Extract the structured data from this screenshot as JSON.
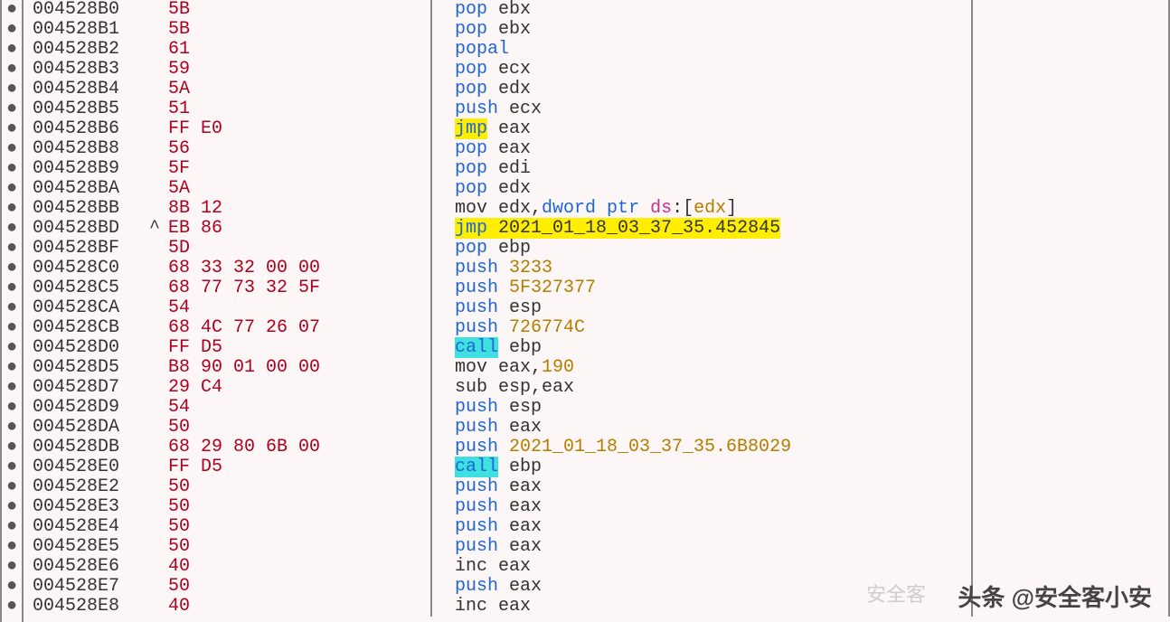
{
  "watermark": "头条 @安全客小安",
  "faded_text": "安全客",
  "rows": [
    {
      "addr": "004528B0",
      "marker": "",
      "bytes": "5B",
      "asm": [
        {
          "t": "pop ",
          "c": "mn"
        },
        {
          "t": "ebx",
          "c": "reg"
        }
      ]
    },
    {
      "addr": "004528B1",
      "marker": "",
      "bytes": "5B",
      "asm": [
        {
          "t": "pop ",
          "c": "mn"
        },
        {
          "t": "ebx",
          "c": "reg"
        }
      ]
    },
    {
      "addr": "004528B2",
      "marker": "",
      "bytes": "61",
      "asm": [
        {
          "t": "popal",
          "c": "mn"
        }
      ]
    },
    {
      "addr": "004528B3",
      "marker": "",
      "bytes": "59",
      "asm": [
        {
          "t": "pop ",
          "c": "mn"
        },
        {
          "t": "ecx",
          "c": "reg"
        }
      ]
    },
    {
      "addr": "004528B4",
      "marker": "",
      "bytes": "5A",
      "asm": [
        {
          "t": "pop ",
          "c": "mn"
        },
        {
          "t": "edx",
          "c": "reg"
        }
      ]
    },
    {
      "addr": "004528B5",
      "marker": "",
      "bytes": "51",
      "asm": [
        {
          "t": "push ",
          "c": "mn"
        },
        {
          "t": "ecx",
          "c": "reg"
        }
      ]
    },
    {
      "addr": "004528B6",
      "marker": "",
      "bytes": "FF E0",
      "asm": [
        {
          "t": "jmp",
          "c": "hl-y"
        },
        {
          "t": " ",
          "c": "txt"
        },
        {
          "t": "eax",
          "c": "reg"
        }
      ]
    },
    {
      "addr": "004528B8",
      "marker": "",
      "bytes": "56",
      "asm": [
        {
          "t": "pop ",
          "c": "mn"
        },
        {
          "t": "eax",
          "c": "reg"
        }
      ]
    },
    {
      "addr": "004528B9",
      "marker": "",
      "bytes": "5F",
      "asm": [
        {
          "t": "pop ",
          "c": "mn"
        },
        {
          "t": "edi",
          "c": "reg"
        }
      ]
    },
    {
      "addr": "004528BA",
      "marker": "",
      "bytes": "5A",
      "asm": [
        {
          "t": "pop ",
          "c": "mn"
        },
        {
          "t": "edx",
          "c": "reg"
        }
      ]
    },
    {
      "addr": "004528BB",
      "marker": "",
      "bytes": "8B 12",
      "asm": [
        {
          "t": "mov ",
          "c": "txt"
        },
        {
          "t": "edx",
          "c": "reg"
        },
        {
          "t": ",",
          "c": "txt"
        },
        {
          "t": "dword ptr ",
          "c": "mn"
        },
        {
          "t": "ds",
          "c": "seg"
        },
        {
          "t": ":[",
          "c": "txt"
        },
        {
          "t": "edx",
          "c": "num"
        },
        {
          "t": "]",
          "c": "txt"
        }
      ]
    },
    {
      "addr": "004528BD",
      "marker": "^",
      "bytes": "EB 86",
      "asm": [
        {
          "t": "jmp",
          "c": "hl-y"
        },
        {
          "t": " ",
          "c": "hl-y2"
        },
        {
          "t": "2021_01_18_03_37_35.452845",
          "c": "hl-y2"
        }
      ]
    },
    {
      "addr": "004528BF",
      "marker": "",
      "bytes": "5D",
      "asm": [
        {
          "t": "pop ",
          "c": "mn"
        },
        {
          "t": "ebp",
          "c": "reg"
        }
      ]
    },
    {
      "addr": "004528C0",
      "marker": "",
      "bytes": "68 33 32 00 00",
      "asm": [
        {
          "t": "push ",
          "c": "mn"
        },
        {
          "t": "3233",
          "c": "num"
        }
      ]
    },
    {
      "addr": "004528C5",
      "marker": "",
      "bytes": "68 77 73 32 5F",
      "asm": [
        {
          "t": "push ",
          "c": "mn"
        },
        {
          "t": "5F327377",
          "c": "num"
        }
      ]
    },
    {
      "addr": "004528CA",
      "marker": "",
      "bytes": "54",
      "asm": [
        {
          "t": "push ",
          "c": "mn"
        },
        {
          "t": "esp",
          "c": "reg"
        }
      ]
    },
    {
      "addr": "004528CB",
      "marker": "",
      "bytes": "68 4C 77 26 07",
      "asm": [
        {
          "t": "push ",
          "c": "mn"
        },
        {
          "t": "726774C",
          "c": "num"
        }
      ]
    },
    {
      "addr": "004528D0",
      "marker": "",
      "bytes": "FF D5",
      "asm": [
        {
          "t": "call",
          "c": "hl-c"
        },
        {
          "t": " ",
          "c": "txt"
        },
        {
          "t": "ebp",
          "c": "reg"
        }
      ]
    },
    {
      "addr": "004528D5",
      "marker": "",
      "bytes": "B8 90 01 00 00",
      "asm": [
        {
          "t": "mov ",
          "c": "txt"
        },
        {
          "t": "eax",
          "c": "reg"
        },
        {
          "t": ",",
          "c": "txt"
        },
        {
          "t": "190",
          "c": "num"
        }
      ]
    },
    {
      "addr": "004528D7",
      "marker": "",
      "bytes": "29 C4",
      "asm": [
        {
          "t": "sub ",
          "c": "txt"
        },
        {
          "t": "esp",
          "c": "reg"
        },
        {
          "t": ",",
          "c": "txt"
        },
        {
          "t": "eax",
          "c": "reg"
        }
      ]
    },
    {
      "addr": "004528D9",
      "marker": "",
      "bytes": "54",
      "asm": [
        {
          "t": "push ",
          "c": "mn"
        },
        {
          "t": "esp",
          "c": "reg"
        }
      ]
    },
    {
      "addr": "004528DA",
      "marker": "",
      "bytes": "50",
      "asm": [
        {
          "t": "push ",
          "c": "mn"
        },
        {
          "t": "eax",
          "c": "reg"
        }
      ]
    },
    {
      "addr": "004528DB",
      "marker": "",
      "bytes": "68 29 80 6B 00",
      "asm": [
        {
          "t": "push ",
          "c": "mn"
        },
        {
          "t": "2021_01_18_03_37_35.6B8029",
          "c": "num"
        }
      ]
    },
    {
      "addr": "004528E0",
      "marker": "",
      "bytes": "FF D5",
      "asm": [
        {
          "t": "call",
          "c": "hl-c"
        },
        {
          "t": " ",
          "c": "txt"
        },
        {
          "t": "ebp",
          "c": "reg"
        }
      ]
    },
    {
      "addr": "004528E2",
      "marker": "",
      "bytes": "50",
      "asm": [
        {
          "t": "push ",
          "c": "mn"
        },
        {
          "t": "eax",
          "c": "reg"
        }
      ]
    },
    {
      "addr": "004528E3",
      "marker": "",
      "bytes": "50",
      "asm": [
        {
          "t": "push ",
          "c": "mn"
        },
        {
          "t": "eax",
          "c": "reg"
        }
      ]
    },
    {
      "addr": "004528E4",
      "marker": "",
      "bytes": "50",
      "asm": [
        {
          "t": "push ",
          "c": "mn"
        },
        {
          "t": "eax",
          "c": "reg"
        }
      ]
    },
    {
      "addr": "004528E5",
      "marker": "",
      "bytes": "50",
      "asm": [
        {
          "t": "push ",
          "c": "mn"
        },
        {
          "t": "eax",
          "c": "reg"
        }
      ]
    },
    {
      "addr": "004528E6",
      "marker": "",
      "bytes": "40",
      "asm": [
        {
          "t": "inc ",
          "c": "txt"
        },
        {
          "t": "eax",
          "c": "reg"
        }
      ]
    },
    {
      "addr": "004528E7",
      "marker": "",
      "bytes": "50",
      "asm": [
        {
          "t": "push ",
          "c": "mn"
        },
        {
          "t": "eax",
          "c": "reg"
        }
      ]
    },
    {
      "addr": "004528E8",
      "marker": "",
      "bytes": "40",
      "asm": [
        {
          "t": "inc ",
          "c": "txt"
        },
        {
          "t": "eax",
          "c": "reg"
        }
      ]
    }
  ]
}
